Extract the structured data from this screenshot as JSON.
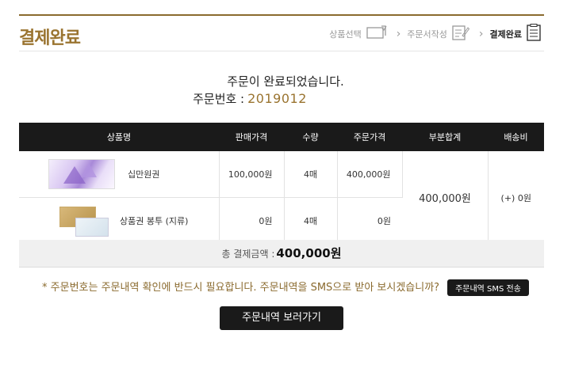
{
  "page": {
    "title": "결제완료"
  },
  "steps": [
    {
      "label": "상품선택",
      "icon": "card-icon"
    },
    {
      "label": "주문서작성",
      "icon": "edit-form-icon"
    },
    {
      "label": "결제완료",
      "icon": "checklist-icon"
    }
  ],
  "message": {
    "complete": "주문이 완료되었습니다.",
    "order_label": "주문번호 :",
    "order_number": "2019012"
  },
  "table": {
    "headers": [
      "상품명",
      "판매가격",
      "수량",
      "주문가격",
      "부분합계",
      "배송비"
    ],
    "rows": [
      {
        "name": "십만원권",
        "price": "100,000원",
        "qty": "4매",
        "total": "400,000원"
      },
      {
        "name": "상품권 봉투 (지류)",
        "price": "0원",
        "qty": "4매",
        "total": "0원"
      }
    ],
    "subtotal": "400,000원",
    "shipping": "(+) 0원"
  },
  "summary": {
    "label": "총 결제금액 :",
    "amount": "400,000원"
  },
  "notice": {
    "text": "* 주문번호는 주문내역 확인에 반드시 필요합니다. 주문내역을 SMS으로 받아 보시겠습니까?",
    "sms_button": "주문내역 SMS 전송"
  },
  "view_button": "주문내역 보러가기",
  "colors": {
    "accent": "#9a7430",
    "header_bg": "#1a1a1a"
  }
}
